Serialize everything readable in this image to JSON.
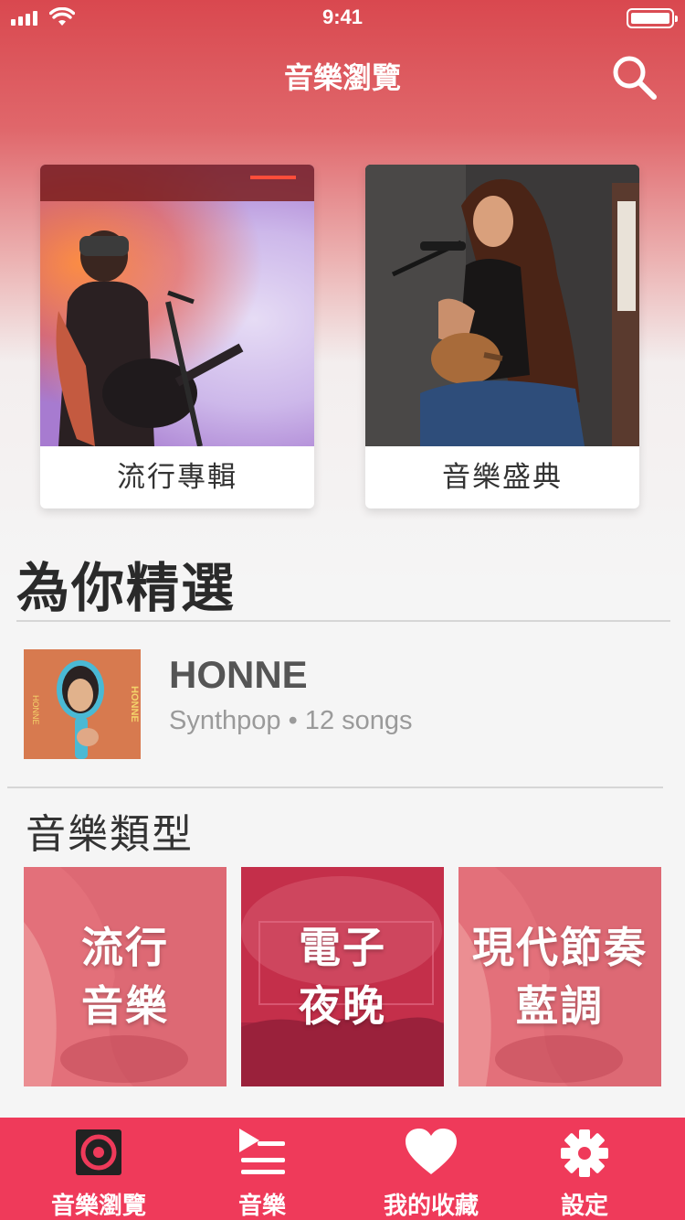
{
  "status_bar": {
    "time": "9:41"
  },
  "nav": {
    "title": "音樂瀏覽",
    "search_icon": "search-icon"
  },
  "featured": [
    {
      "label": "流行專輯"
    },
    {
      "label": "音樂盛典"
    }
  ],
  "section": {
    "title": "為你精選"
  },
  "pick": {
    "artist": "HONNE",
    "meta": "Synthpop • 12 songs",
    "cover_text": "HONNE"
  },
  "genres": {
    "heading": "音樂類型",
    "items": [
      {
        "line1": "流行",
        "line2": "音樂",
        "color": "#e0626e"
      },
      {
        "line1": "電子",
        "line2": "夜晚",
        "color": "#c92f4b"
      },
      {
        "line1": "現代節奏",
        "line2": "藍調",
        "color": "#e0626e"
      }
    ]
  },
  "tabbar": {
    "items": [
      {
        "label": "音樂瀏覽",
        "icon": "speaker-icon"
      },
      {
        "label": "音樂",
        "icon": "playlist-icon"
      },
      {
        "label": "我的收藏",
        "icon": "heart-icon"
      },
      {
        "label": "設定",
        "icon": "gear-icon"
      }
    ],
    "background": "#ef3a5a"
  }
}
